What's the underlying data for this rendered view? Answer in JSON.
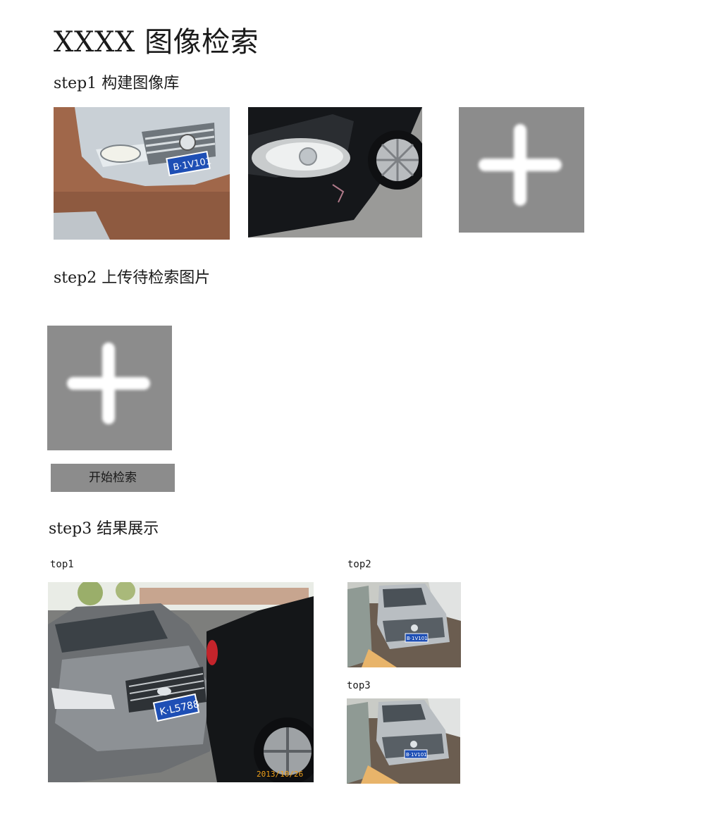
{
  "page": {
    "title": "XXXX 图像检索"
  },
  "step1": {
    "heading": "step1 构建图像库",
    "add_tile_icon": "plus-icon"
  },
  "step2": {
    "heading": "step2 上传待检索图片",
    "add_tile_icon": "plus-icon",
    "search_button_label": "开始检索"
  },
  "step3": {
    "heading": "step3 结果展示",
    "results": [
      {
        "label": "top1",
        "plate_text": "K·L5788",
        "date_stamp": "2013/10/26"
      },
      {
        "label": "top2",
        "plate_text": "B·1V101"
      },
      {
        "label": "top3",
        "plate_text": "B·1V101"
      }
    ]
  },
  "library": {
    "images": [
      {
        "plate_text": "B·1V101"
      },
      {
        "plate_text": ""
      }
    ]
  },
  "colors": {
    "tile_gray": "#8c8c8c",
    "plate_blue": "#1e4fb5",
    "background": "#ffffff"
  }
}
